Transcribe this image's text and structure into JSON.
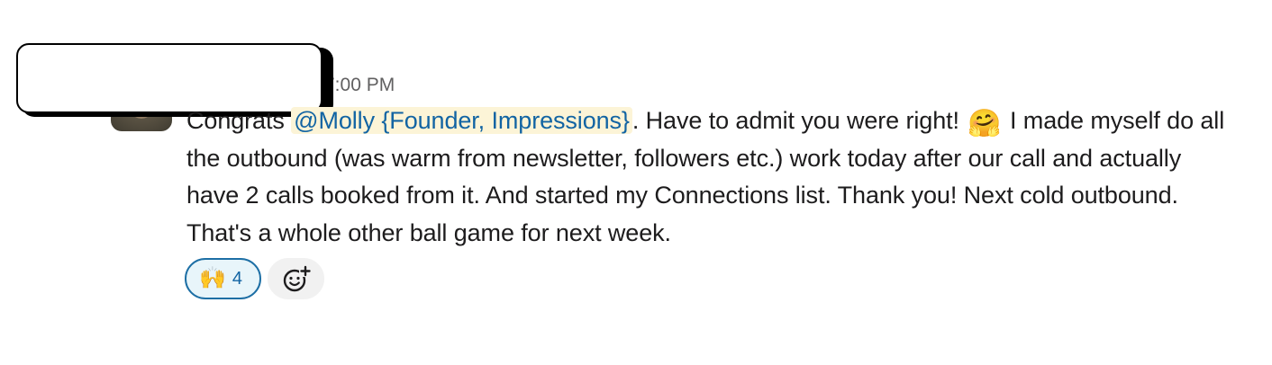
{
  "message": {
    "timestamp": "7:00 PM",
    "text_before_mention": "Congrats ",
    "mention": "@Molly {Founder, Impressions}",
    "text_after_mention": ". Have to admit you were right! ",
    "inline_emoji": "🤗",
    "text_after_emoji": " I made myself do all the outbound (was warm from newsletter, followers etc.) work today after our call and actually have 2 calls booked from it. And started my Connections list. Thank you! Next cold outbound. That's a whole other ball game for next week."
  },
  "reactions": [
    {
      "emoji": "🙌",
      "count": "4",
      "active": true
    }
  ],
  "add_reaction": {
    "icon": "add-emoji-icon"
  },
  "colors": {
    "mention_text": "#1264a3",
    "mention_bg": "#fcf4d7",
    "reaction_border": "#1d6fa5",
    "reaction_bg": "#e8f5fa",
    "timestamp": "#616061",
    "text": "#1d1c1d"
  }
}
